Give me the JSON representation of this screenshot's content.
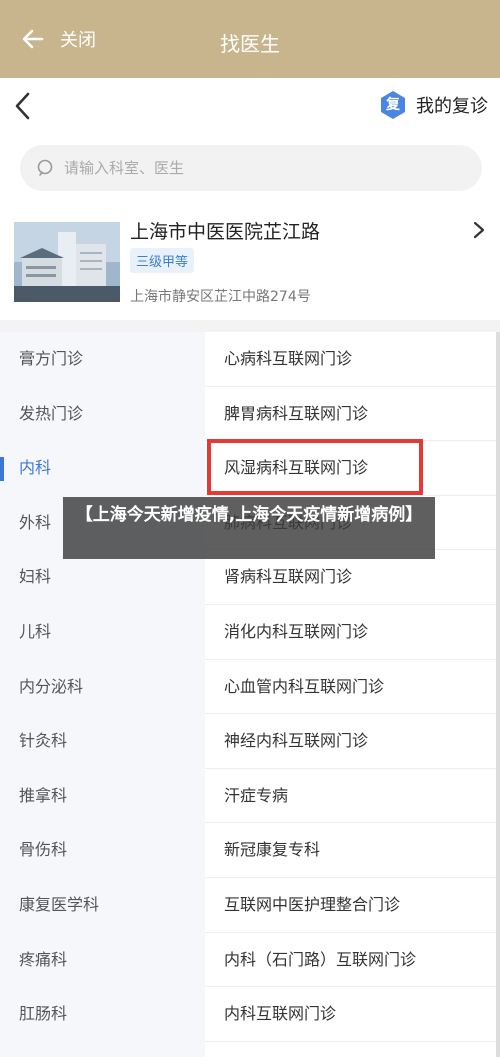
{
  "topbar": {
    "close_label": "关闭",
    "title": "找医生"
  },
  "nav": {
    "my_review_badge": "复",
    "my_review_label": "我的复诊"
  },
  "search": {
    "placeholder": "请输入科室、医生"
  },
  "hospital": {
    "name": "上海市中医医院芷江路",
    "level": "三级甲等",
    "address": "上海市静安区芷江中路274号"
  },
  "departments": [
    "膏方门诊",
    "发热门诊",
    "内科",
    "外科",
    "妇科",
    "儿科",
    "内分泌科",
    "针灸科",
    "推拿科",
    "骨伤科",
    "康复医学科",
    "疼痛科",
    "肛肠科"
  ],
  "active_department": "内科",
  "clinics": [
    "心病科互联网门诊",
    "脾胃病科互联网门诊",
    "风湿病科互联网门诊",
    "肺病科互联网门诊",
    "肾病科互联网门诊",
    "消化内科互联网门诊",
    "心血管内科互联网门诊",
    "神经内科互联网门诊",
    "汗症专病",
    "新冠康复专科",
    "互联网中医护理整合门诊",
    "内科（石门路）互联网门诊",
    "内科互联网门诊"
  ],
  "overlay_caption": "【上海今天新增疫情,上海今天疫情新增病例】",
  "colors": {
    "topbar": "#c8b48d",
    "accent": "#3d78d8",
    "highlight": "#e53935"
  }
}
